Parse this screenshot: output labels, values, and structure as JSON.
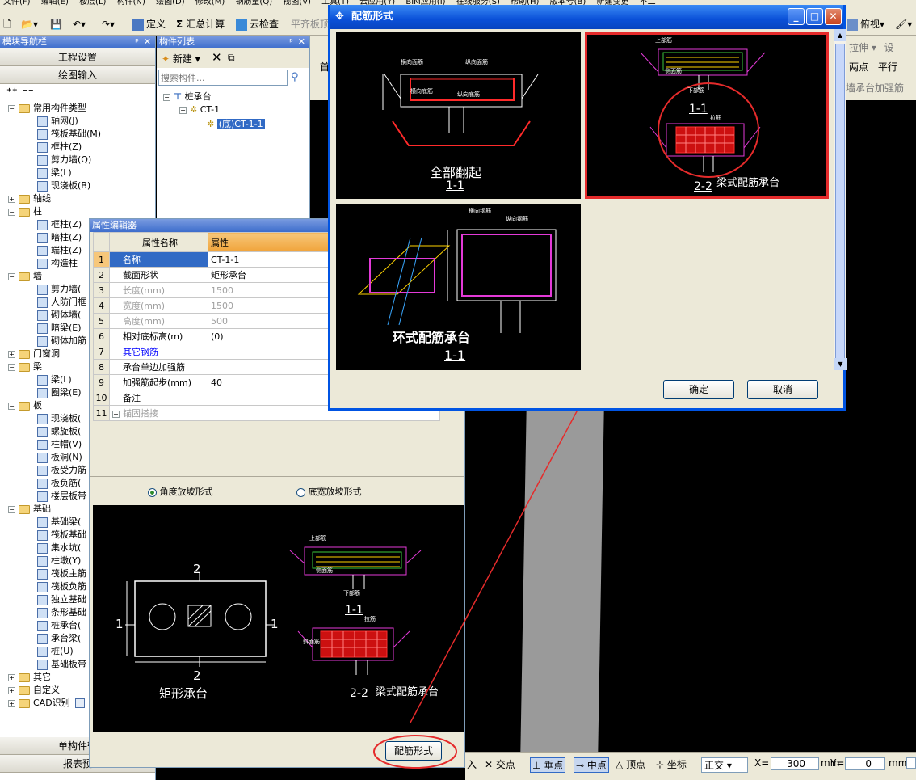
{
  "menubar": {
    "items": [
      "文件(F)",
      "编辑(E)",
      "楼层(L)",
      "构件(N)",
      "绘图(D)",
      "修改(M)",
      "钢筋量(Q)",
      "视图(V)",
      "工具(T)",
      "云应用(Y)",
      "BIM应用(I)",
      "在线服务(S)",
      "帮助(H)",
      "版本号(B)",
      "新建变更",
      "不二"
    ]
  },
  "toolbar": {
    "define": "定义",
    "sum_calc": "汇总计算",
    "cloud_check": "云检查",
    "flat_board": "平齐板顶",
    "top_view": "俯视",
    "stretch": "拉伸",
    "settings": "设",
    "two_point": "两点",
    "parallel": "平行",
    "strengthen": "墙承台加强筋",
    "first_tab": "首"
  },
  "nav": {
    "title": "模块导航栏",
    "btn_project": "工程设置",
    "btn_draw": "绘图输入",
    "bottom_single": "单构件输",
    "bottom_report": "报表预",
    "tree": [
      {
        "lvl": 0,
        "exp": "-",
        "folder": true,
        "label": "常用构件类型"
      },
      {
        "lvl": 1,
        "label": "轴网(J)"
      },
      {
        "lvl": 1,
        "label": "筏板基础(M)"
      },
      {
        "lvl": 1,
        "label": "框柱(Z)"
      },
      {
        "lvl": 1,
        "label": "剪力墙(Q)"
      },
      {
        "lvl": 1,
        "label": "梁(L)"
      },
      {
        "lvl": 1,
        "label": "现浇板(B)"
      },
      {
        "lvl": 0,
        "exp": "+",
        "folder": true,
        "label": "轴线"
      },
      {
        "lvl": 0,
        "exp": "-",
        "folder": true,
        "label": "柱"
      },
      {
        "lvl": 1,
        "label": "框柱(Z)"
      },
      {
        "lvl": 1,
        "label": "暗柱(Z)"
      },
      {
        "lvl": 1,
        "label": "端柱(Z)"
      },
      {
        "lvl": 1,
        "label": "构造柱"
      },
      {
        "lvl": 0,
        "exp": "-",
        "folder": true,
        "label": "墙"
      },
      {
        "lvl": 1,
        "label": "剪力墙("
      },
      {
        "lvl": 1,
        "label": "人防门框"
      },
      {
        "lvl": 1,
        "label": "砌体墙("
      },
      {
        "lvl": 1,
        "label": "暗梁(E)"
      },
      {
        "lvl": 1,
        "label": "砌体加筋"
      },
      {
        "lvl": 0,
        "exp": "+",
        "folder": true,
        "label": "门窗洞"
      },
      {
        "lvl": 0,
        "exp": "-",
        "folder": true,
        "label": "梁"
      },
      {
        "lvl": 1,
        "label": "梁(L)"
      },
      {
        "lvl": 1,
        "label": "圈梁(E)"
      },
      {
        "lvl": 0,
        "exp": "-",
        "folder": true,
        "label": "板"
      },
      {
        "lvl": 1,
        "label": "现浇板("
      },
      {
        "lvl": 1,
        "label": "螺旋板("
      },
      {
        "lvl": 1,
        "label": "柱帽(V)"
      },
      {
        "lvl": 1,
        "label": "板洞(N)"
      },
      {
        "lvl": 1,
        "label": "板受力筋"
      },
      {
        "lvl": 1,
        "label": "板负筋("
      },
      {
        "lvl": 1,
        "label": "楼层板带"
      },
      {
        "lvl": 0,
        "exp": "-",
        "folder": true,
        "label": "基础"
      },
      {
        "lvl": 1,
        "label": "基础梁("
      },
      {
        "lvl": 1,
        "label": "筏板基础"
      },
      {
        "lvl": 1,
        "label": "集水坑("
      },
      {
        "lvl": 1,
        "label": "柱墩(Y)"
      },
      {
        "lvl": 1,
        "label": "筏板主筋"
      },
      {
        "lvl": 1,
        "label": "筏板负筋"
      },
      {
        "lvl": 1,
        "label": "独立基础"
      },
      {
        "lvl": 1,
        "label": "条形基础"
      },
      {
        "lvl": 1,
        "label": "桩承台("
      },
      {
        "lvl": 1,
        "label": "承台梁("
      },
      {
        "lvl": 1,
        "label": "桩(U)"
      },
      {
        "lvl": 1,
        "label": "基础板带"
      },
      {
        "lvl": 0,
        "exp": "+",
        "folder": true,
        "label": "其它"
      },
      {
        "lvl": 0,
        "exp": "+",
        "folder": true,
        "label": "自定义"
      },
      {
        "lvl": 0,
        "exp": "+",
        "folder": true,
        "label": "CAD识别"
      }
    ]
  },
  "clist": {
    "title": "构件列表",
    "new_label": "新建",
    "search_placeholder": "搜索构件...",
    "node_root": "桩承台",
    "node_ct": "CT-1",
    "node_sel": "(底)CT-1-1"
  },
  "prop": {
    "title": "属性编辑器",
    "col_name": "属性名称",
    "col_value": "属性",
    "rows": [
      {
        "n": "1",
        "name": "名称",
        "value": "CT-1-1",
        "cls": "sel"
      },
      {
        "n": "2",
        "name": "截面形状",
        "value": "矩形承台",
        "cls": ""
      },
      {
        "n": "3",
        "name": "长度(mm)",
        "value": "1500",
        "cls": "gray"
      },
      {
        "n": "4",
        "name": "宽度(mm)",
        "value": "1500",
        "cls": "gray"
      },
      {
        "n": "5",
        "name": "高度(mm)",
        "value": "500",
        "cls": "gray"
      },
      {
        "n": "6",
        "name": "相对底标高(m)",
        "value": "(0)",
        "cls": ""
      },
      {
        "n": "7",
        "name": "其它钢筋",
        "value": "",
        "cls": "blue"
      },
      {
        "n": "8",
        "name": "承台单边加强筋",
        "value": "",
        "cls": ""
      },
      {
        "n": "9",
        "name": "加强筋起步(mm)",
        "value": "40",
        "cls": ""
      },
      {
        "n": "10",
        "name": "备注",
        "value": "",
        "cls": ""
      },
      {
        "n": "11",
        "name": "锚固搭接",
        "value": "",
        "cls": "gray"
      }
    ],
    "radio_angle": "角度放坡形式",
    "radio_width": "底宽放坡形式",
    "preview_rect_label": "矩形承台",
    "preview_beam_label": "梁式配筋承台",
    "rebar_btn": "配筋形式",
    "dim_2": "2",
    "dim_1": "1",
    "sec_11": "1-1",
    "sec_22": "2-2",
    "top_bar": "上部筋",
    "bot_bar": "下部筋",
    "side_bar": "侧面筋",
    "tie_bar": "拉筋",
    "slope_bar": "斜面筋"
  },
  "dialog": {
    "title": "配筋形式",
    "opt1_label": "全部翻起",
    "opt1_sec": "1-1",
    "opt2_label": "梁式配筋承台",
    "opt2_sec1": "1-1",
    "opt2_sec2": "2-2",
    "opt3_label": "环式配筋承台",
    "opt3_sec": "1-1",
    "ok": "确定",
    "cancel": "取消",
    "t_hx": "横向面筋",
    "t_zx": "纵向面筋",
    "t_hd": "横向底筋",
    "t_zd": "纵向底筋",
    "t_hxg": "横向钢筋",
    "t_zxg": "纵向钢筋",
    "t_tie": "拉筋",
    "t_top": "上部筋",
    "t_bot": "下部筋",
    "t_side": "侧面筋"
  },
  "status": {
    "input": "入",
    "intersect": "交点",
    "perp": "垂点",
    "mid": "中点",
    "vertex": "顶点",
    "coord": "坐标",
    "ortho": "正交",
    "x_label": "X=",
    "x_value": "300",
    "y_label": "Y=",
    "y_value": "0",
    "unit": "mm"
  },
  "colors": {
    "title_blue": "#0054e3",
    "highlight_red": "#e52b2b",
    "panel": "#ece9d8"
  }
}
